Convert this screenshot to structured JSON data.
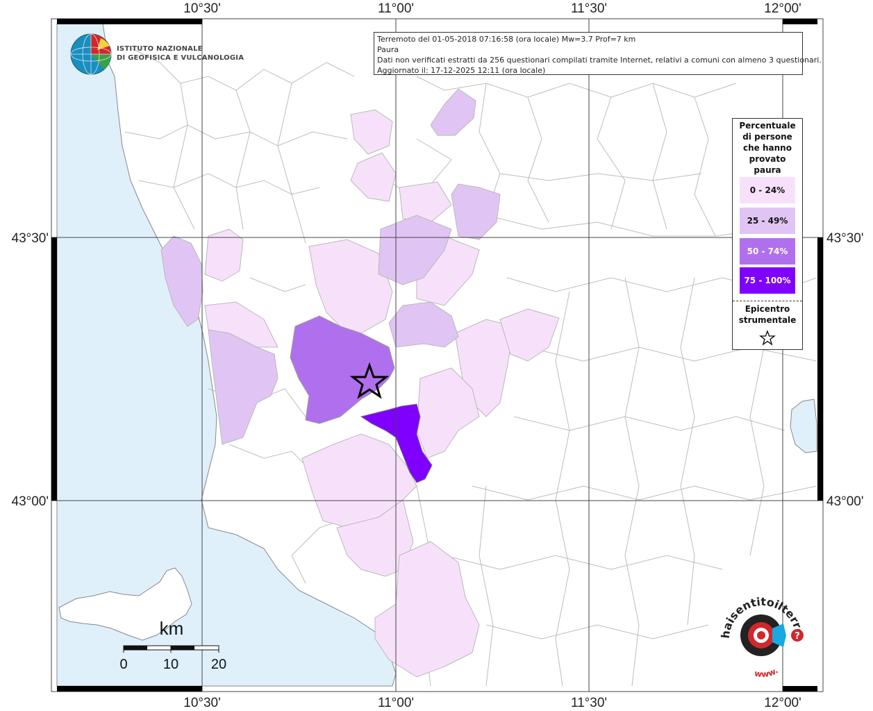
{
  "header": {
    "line1": "Terremoto del 01-05-2018 07:16:58 (ora locale) Mw=3.7 Prof=7 km",
    "line2": "Paura",
    "line3": "Dati non verificati estratti da 256 questionari compilati tramite Internet, relativi a comuni con almeno 3 questionari.",
    "line4": "Aggiornato il: 17-12-2025 12:11 (ora locale)"
  },
  "institute": {
    "line1": "ISTITUTO NAZIONALE",
    "line2": "DI GEOFISICA E VULCANOLOGIA"
  },
  "axes": {
    "lon_top": [
      "10°30'",
      "11°00'",
      "11°30'",
      "12°00'"
    ],
    "lon_bottom": [
      "10°30'",
      "11°00'",
      "11°30'",
      "12°00'"
    ],
    "lat_left": [
      "43°30'",
      "43°00'"
    ],
    "lat_right": [
      "43°30'",
      "43°00'"
    ]
  },
  "legend": {
    "title": [
      "Percentuale",
      "di persone",
      "che hanno",
      "provato",
      "paura"
    ],
    "classes": [
      {
        "label": "0 - 24%",
        "color": "#f7e1fa"
      },
      {
        "label": "25 - 49%",
        "color": "#e0c5f4"
      },
      {
        "label": "50 - 74%",
        "color": "#b070ee"
      },
      {
        "label": "75 - 100%",
        "color": "#8000ff"
      }
    ],
    "epicenter_label": [
      "Epicentro",
      "strumentale"
    ]
  },
  "scalebar": {
    "unit": "km",
    "ticks": [
      "0",
      "10",
      "20"
    ]
  },
  "watermark": {
    "text_top": "haisentitoilterremoto.it",
    "text_bottom": "www.",
    "question": "?"
  },
  "colors": {
    "sea": "#dff0fb",
    "land": "#ffffff",
    "border": "#b8b8b8",
    "grid": "#444444"
  }
}
